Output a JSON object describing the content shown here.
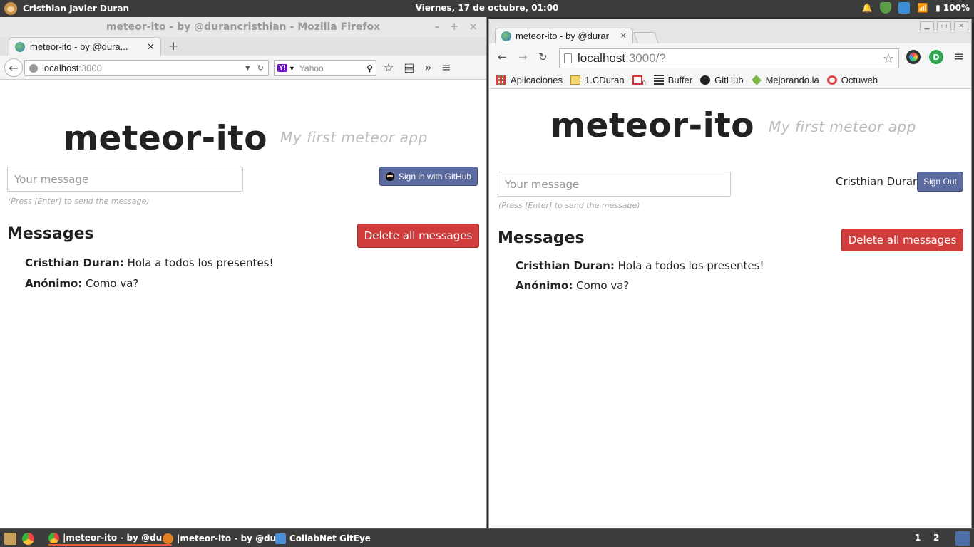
{
  "top_panel": {
    "user_name": "Cristhian Javier Duran",
    "clock": "Viernes, 17 de octubre, 01:00",
    "battery": "100%"
  },
  "firefox": {
    "window_title": "meteor-ito - by @durancristhian - Mozilla Firefox",
    "tab_title": "meteor-ito - by @dura...",
    "url_host": "localhost",
    "url_port": ":3000",
    "search_placeholder": "Yahoo",
    "search_engine_badge": "Y!"
  },
  "chrome": {
    "tab_title": "meteor-ito - by @durar",
    "url_host": "localhost",
    "url_port": ":3000/?",
    "bookmarks": [
      {
        "label": "Aplicaciones",
        "icon": "apps-icon"
      },
      {
        "label": "1.CDuran",
        "icon": "folder-icon"
      },
      {
        "label": "",
        "icon": "gmail-icon"
      },
      {
        "label": "Buffer",
        "icon": "buffer-icon"
      },
      {
        "label": "GitHub",
        "icon": "github-icon"
      },
      {
        "label": "Mejorando.la",
        "icon": "mejorando-icon"
      },
      {
        "label": "Octuweb",
        "icon": "octuweb-icon"
      }
    ],
    "gmail_badge": "0"
  },
  "app": {
    "title": "meteor-ito",
    "subtitle": "My first meteor app",
    "input_placeholder": "Your message",
    "hint": "(Press [Enter] to send the message)",
    "signin_label": "Sign in with GitHub",
    "signed_in_user": "Cristhian Duran",
    "signout_label": "Sign Out",
    "messages_heading": "Messages",
    "delete_label": "Delete all messages",
    "messages": [
      {
        "author": "Cristhian Duran:",
        "text": "Hola a todos los presentes!"
      },
      {
        "author": "Anónimo:",
        "text": "Como va?"
      }
    ]
  },
  "bottom_panel": {
    "tasks": [
      {
        "label": "|meteor-ito - by @du..."
      },
      {
        "label": "|meteor-ito - by @du..."
      },
      {
        "label": "CollabNet GitEye"
      }
    ],
    "workspaces": [
      "1",
      "2"
    ]
  },
  "colors": {
    "delete_button": "#d13c3c",
    "github_button": "#5b6b9f"
  }
}
